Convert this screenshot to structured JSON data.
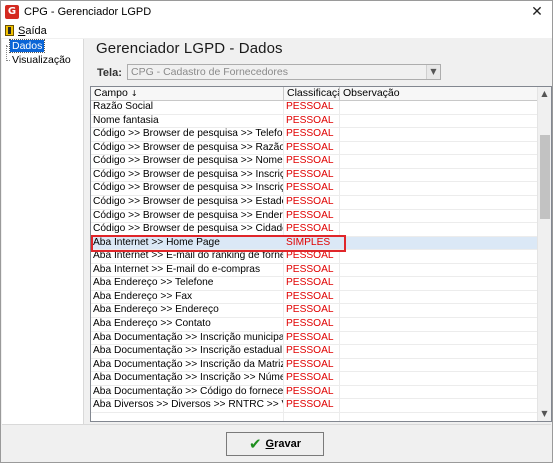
{
  "window": {
    "title": "CPG - Gerenciador LGPD",
    "app_icon": "G",
    "close_glyph": "✕"
  },
  "menu": {
    "saida_first": "S",
    "saida_rest": "aída"
  },
  "tree": {
    "items": [
      "Dados",
      "Visualização"
    ]
  },
  "main": {
    "title": "Gerenciador LGPD - Dados",
    "tela_label": "Tela:",
    "tela_value": "CPG - Cadastro de Fornecedores"
  },
  "grid": {
    "headers": {
      "campo": "Campo",
      "classificacao": "Classificação",
      "observacao": "Observação"
    },
    "highlight_row_index": 11,
    "rows": [
      {
        "campo": "Razão Social",
        "classificacao": "PESSOAL",
        "observacao": ""
      },
      {
        "campo": "Nome fantasia",
        "classificacao": "PESSOAL",
        "observacao": ""
      },
      {
        "campo": "Código >> Browser de pesquisa >> Telefone",
        "classificacao": "PESSOAL",
        "observacao": ""
      },
      {
        "campo": "Código >> Browser de pesquisa >> Razão social",
        "classificacao": "PESSOAL",
        "observacao": ""
      },
      {
        "campo": "Código >> Browser de pesquisa >> Nome fantasia",
        "classificacao": "PESSOAL",
        "observacao": ""
      },
      {
        "campo": "Código >> Browser de pesquisa >> Inscrição Esta...",
        "classificacao": "PESSOAL",
        "observacao": ""
      },
      {
        "campo": "Código >> Browser de pesquisa >> Inscrição",
        "classificacao": "PESSOAL",
        "observacao": ""
      },
      {
        "campo": "Código >> Browser de pesquisa >> Estado",
        "classificacao": "PESSOAL",
        "observacao": ""
      },
      {
        "campo": "Código >> Browser de pesquisa >> Endereço",
        "classificacao": "PESSOAL",
        "observacao": ""
      },
      {
        "campo": "Código >> Browser de pesquisa >> Cidade",
        "classificacao": "PESSOAL",
        "observacao": ""
      },
      {
        "campo": "Aba Internet >> Home Page",
        "classificacao": "SIMPLES",
        "observacao": ""
      },
      {
        "campo": "Aba Internet >> E-mail do ranking de fornecedores",
        "classificacao": "PESSOAL",
        "observacao": ""
      },
      {
        "campo": "Aba Internet >> E-mail do e-compras",
        "classificacao": "PESSOAL",
        "observacao": ""
      },
      {
        "campo": "Aba Endereço >> Telefone",
        "classificacao": "PESSOAL",
        "observacao": ""
      },
      {
        "campo": "Aba Endereço >> Fax",
        "classificacao": "PESSOAL",
        "observacao": ""
      },
      {
        "campo": "Aba Endereço >> Endereço",
        "classificacao": "PESSOAL",
        "observacao": ""
      },
      {
        "campo": "Aba Endereço >> Contato",
        "classificacao": "PESSOAL",
        "observacao": ""
      },
      {
        "campo": "Aba Documentação >> Inscrição municipal",
        "classificacao": "PESSOAL",
        "observacao": ""
      },
      {
        "campo": "Aba Documentação >> Inscrição estadual",
        "classificacao": "PESSOAL",
        "observacao": ""
      },
      {
        "campo": "Aba Documentação >> Inscrição da Matriz",
        "classificacao": "PESSOAL",
        "observacao": ""
      },
      {
        "campo": "Aba Documentação >> Inscrição >> Número",
        "classificacao": "PESSOAL",
        "observacao": ""
      },
      {
        "campo": "Aba Documentação >> Código do fornecedor matriz",
        "classificacao": "PESSOAL",
        "observacao": ""
      },
      {
        "campo": "Aba Diversos >> Diversos >> RNTRC >> Validade",
        "classificacao": "PESSOAL",
        "observacao": ""
      },
      {
        "campo": "",
        "classificacao": "",
        "observacao": ""
      }
    ]
  },
  "footer": {
    "gravar_first": "G",
    "gravar_rest": "ravar"
  }
}
